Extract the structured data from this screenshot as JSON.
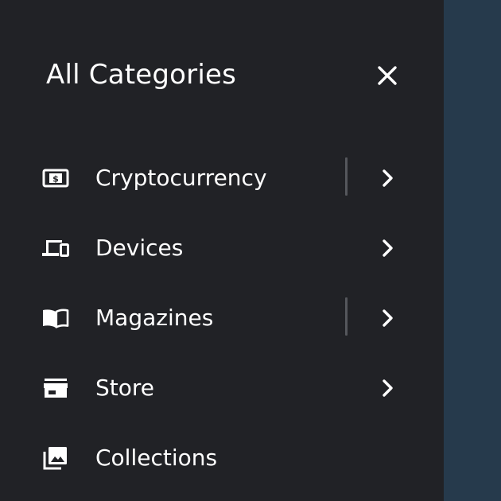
{
  "drawer": {
    "title": "All Categories",
    "close_icon": "close-icon"
  },
  "categories": [
    {
      "label": "Cryptocurrency",
      "icon": "money-bill-icon",
      "has_submenu": true,
      "divider": true
    },
    {
      "label": "Devices",
      "icon": "devices-icon",
      "has_submenu": true,
      "divider": false
    },
    {
      "label": "Magazines",
      "icon": "book-icon",
      "has_submenu": true,
      "divider": true
    },
    {
      "label": "Store",
      "icon": "storefront-icon",
      "has_submenu": true,
      "divider": false
    },
    {
      "label": "Collections",
      "icon": "photo-library-icon",
      "has_submenu": false,
      "divider": false
    }
  ],
  "colors": {
    "drawer_bg": "#212226",
    "backdrop": "#263a4c",
    "text": "#ffffff",
    "divider": "#55575c"
  }
}
